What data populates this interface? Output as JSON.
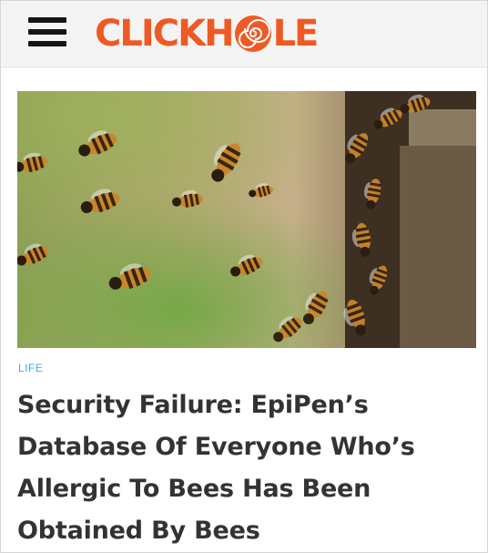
{
  "header": {
    "menu_icon": "hamburger-menu-icon",
    "logo": {
      "text_left": "CLICKH",
      "text_right": "LE",
      "o_icon": "spiral-icon",
      "color": "#ef5a24"
    }
  },
  "article": {
    "image_icon": "bees-photo",
    "category": "LIFE",
    "category_color": "#41aee0",
    "headline": "Security Failure: EpiPen’s Database Of Everyone Who’s Allergic To Bees Has Been Obtained By Bees"
  }
}
